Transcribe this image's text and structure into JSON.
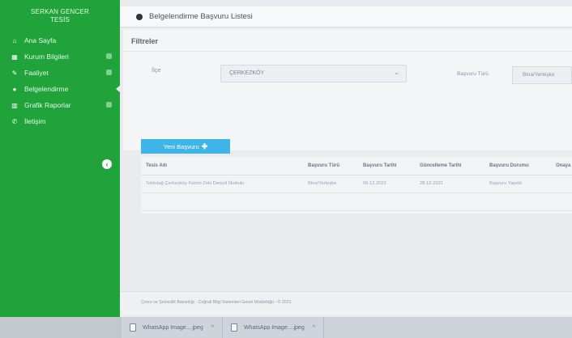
{
  "sidebar": {
    "brand_line1": "SERKAN GENCER",
    "brand_line2": "TESİS",
    "items": [
      {
        "label": "Ana Sayfa",
        "icon": "home-icon",
        "glyph": "⌂"
      },
      {
        "label": "Kurum Bilgileri",
        "icon": "building-icon",
        "glyph": "▦"
      },
      {
        "label": "Faaliyet",
        "icon": "edit-icon",
        "glyph": "✎"
      },
      {
        "label": "Belgelendirme",
        "icon": "circle-icon",
        "glyph": "●"
      },
      {
        "label": "Grafik Raporlar",
        "icon": "bar-chart-icon",
        "glyph": "▥"
      },
      {
        "label": "İletişim",
        "icon": "phone-icon",
        "glyph": "✆"
      }
    ]
  },
  "header": {
    "title": "Belgelendirme Başvuru Listesi"
  },
  "filters": {
    "panel_title": "Filtreler",
    "ilce_label": "İlçe",
    "ilce_value": "ÇERKEZKÖY",
    "tur_label": "Başvuru Türü",
    "tur_value": "Bina/Yerleşke"
  },
  "actions": {
    "new_application_label": "Yeni Başvuru"
  },
  "table": {
    "columns": [
      "Tesis Adı",
      "Başvuru Türü",
      "Başvuru Tarihi",
      "Güncelleme Tarihi",
      "Başvuru Durumu",
      "Onaya Gö"
    ],
    "rows": [
      [
        "Tekirdağ Çerkezköy Fehmi Zeki Denizli İlkokulu",
        "Bina/Yerleşke",
        "06.12.2021",
        "28.12.2021",
        "Başvuru Yapıldı",
        ""
      ]
    ]
  },
  "footer": {
    "text": "Çevre ve Şehircilik Bakanlığı - Coğrafi Bilgi Sistemleri Genel Müdürlüğü - © 2021"
  },
  "taskbar": {
    "downloads": [
      {
        "name": "WhatsApp Image....jpeg"
      },
      {
        "name": "WhatsApp Image....jpeg"
      }
    ]
  },
  "colors": {
    "sidebar": "#1fa33a",
    "primary_button": "#3fb4e8",
    "header_dot": "#2c3440"
  }
}
